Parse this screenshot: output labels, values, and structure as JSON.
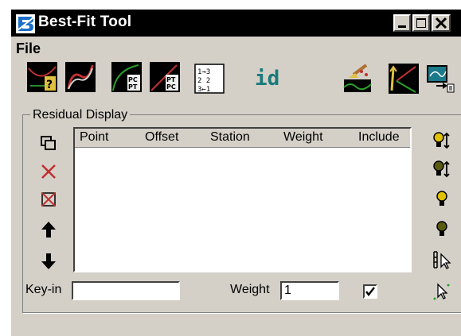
{
  "window": {
    "title": "Best-Fit Tool"
  },
  "menu": {
    "file_label": "File"
  },
  "toolbar": {
    "id_label": "id"
  },
  "residual": {
    "group_label": "Residual Display",
    "columns": [
      "Point",
      "Offset",
      "Station",
      "Weight",
      "Include"
    ]
  },
  "footer": {
    "keyin_label": "Key-in",
    "keyin_value": "",
    "weight_label": "Weight",
    "weight_value": "1",
    "include_checked": true
  }
}
